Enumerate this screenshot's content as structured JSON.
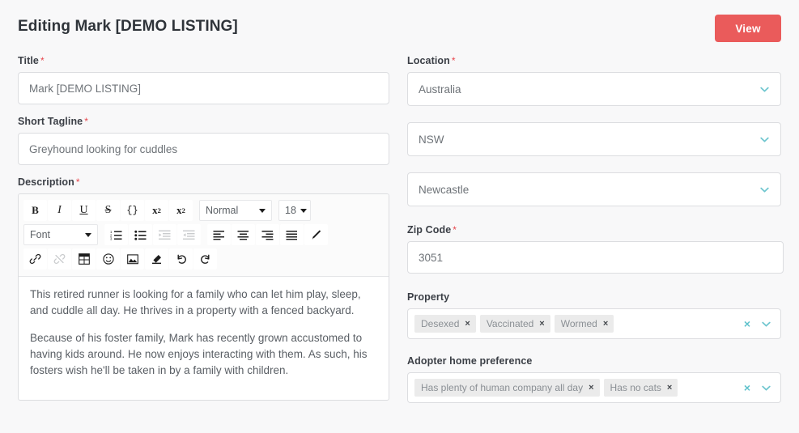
{
  "header": {
    "title": "Editing Mark [DEMO LISTING]",
    "view_button": "View",
    "view_button_color": "#ea5b5b"
  },
  "form": {
    "title": {
      "label": "Title",
      "required": "*",
      "value": "Mark [DEMO LISTING]"
    },
    "short_tagline": {
      "label": "Short Tagline",
      "required": "*",
      "value": "Greyhound looking for cuddles"
    },
    "description": {
      "label": "Description",
      "required": "*",
      "paragraphs": [
        "This retired runner is looking for a family who can let him play, sleep, and cuddle all day. He thrives in a property with a fenced backyard.",
        "Because of his foster family, Mark has recently grown accustomed to having kids around. He now enjoys interacting with them. As such, his fosters wish he'll be taken in by a family with children."
      ]
    },
    "location": {
      "label": "Location",
      "required": "*",
      "country": "Australia",
      "state": "NSW",
      "city": "Newcastle"
    },
    "zip_code": {
      "label": "Zip Code",
      "required": "*",
      "value": "3051"
    },
    "property": {
      "label": "Property",
      "tags": [
        "Desexed",
        "Vaccinated",
        "Wormed"
      ],
      "remove_glyph": "×",
      "clear_glyph": "×"
    },
    "adopter_home_preference": {
      "label": "Adopter home preference",
      "tags": [
        "Has plenty of human company all day",
        "Has no cats"
      ],
      "remove_glyph": "×",
      "clear_glyph": "×"
    }
  },
  "editor_toolbar": {
    "bold": "B",
    "italic": "I",
    "underline": "U",
    "strikethrough": "S",
    "code": "{}",
    "superscript": "x",
    "superscript_sup": "2",
    "subscript": "x",
    "subscript_sub": "2",
    "paragraph_style": "Normal",
    "font_family": "Font",
    "font_size": "18"
  },
  "colors": {
    "accent_teal": "#6fc6cf",
    "required_red": "#e8464d",
    "page_background": "#f8f8f9",
    "tag_background": "#ebebeb"
  }
}
